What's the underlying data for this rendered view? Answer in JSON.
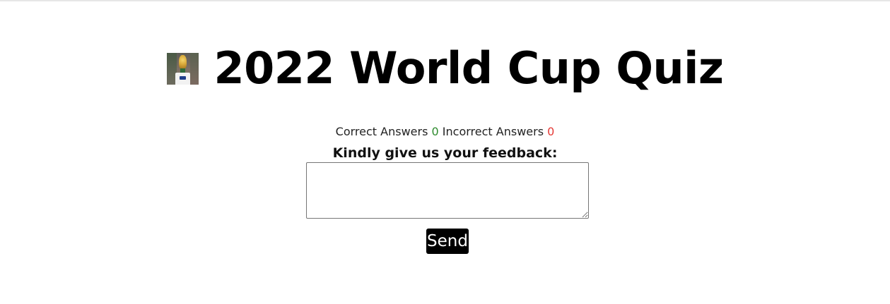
{
  "header": {
    "title": "2022 World Cup Quiz",
    "logo_icon": "trophy-icon"
  },
  "score": {
    "correct_label": "Correct Answers",
    "correct_value": "0",
    "incorrect_label": "Incorrect Answers",
    "incorrect_value": "0",
    "correct_color": "#2e8b2e",
    "incorrect_color": "#e53935"
  },
  "feedback": {
    "label": "Kindly give us your feedback:",
    "value": "",
    "placeholder": "",
    "send_label": "Send"
  }
}
